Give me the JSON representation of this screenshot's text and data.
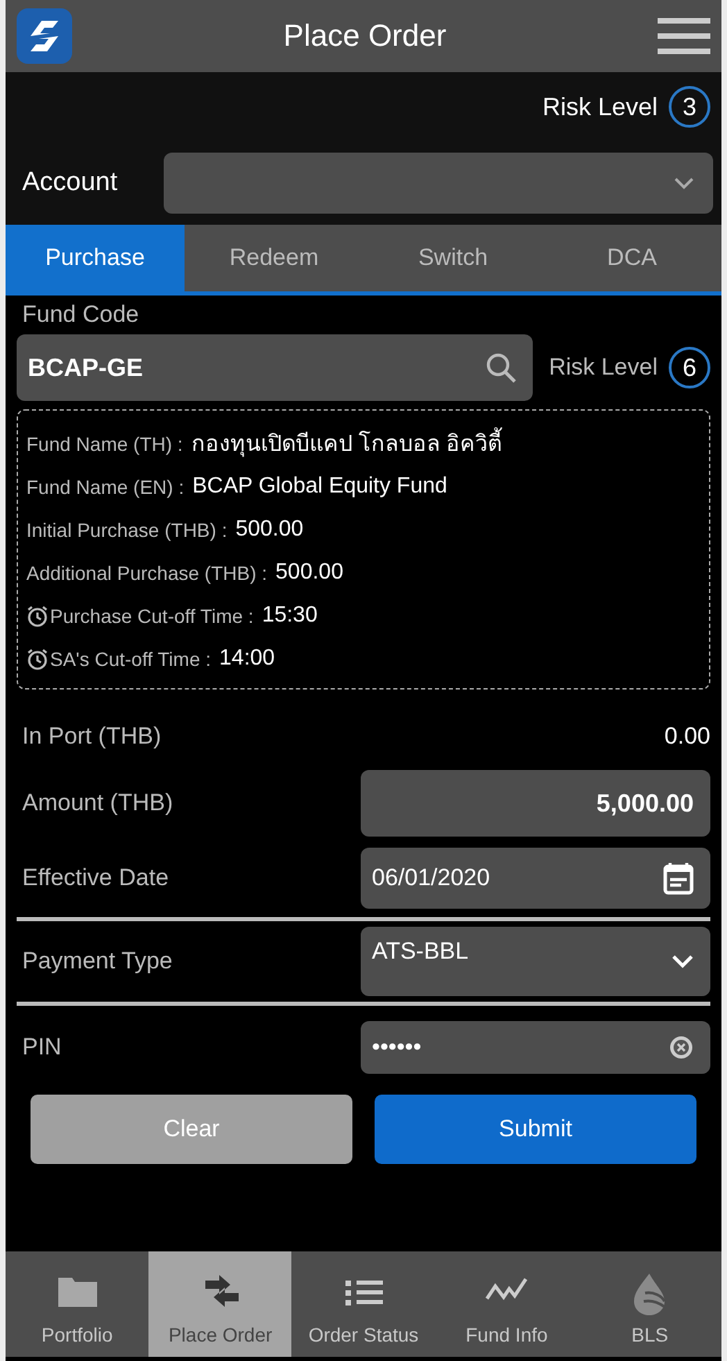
{
  "header": {
    "title": "Place Order"
  },
  "risk": {
    "label": "Risk Level",
    "value": "3"
  },
  "account": {
    "label": "Account"
  },
  "tabs": [
    {
      "label": "Purchase",
      "selected": true
    },
    {
      "label": "Redeem",
      "selected": false
    },
    {
      "label": "Switch",
      "selected": false
    },
    {
      "label": "DCA",
      "selected": false
    }
  ],
  "fund_code": {
    "label": "Fund Code",
    "value": "BCAP-GE",
    "risk_label": "Risk Level",
    "risk_value": "6"
  },
  "fund_info": [
    {
      "kind": "text",
      "label": "Fund Name (TH) :",
      "value": "กองทุนเปิดบีแคป โกลบอล อิควิตี้"
    },
    {
      "kind": "text",
      "label": "Fund Name (EN) :",
      "value": "BCAP Global Equity Fund"
    },
    {
      "kind": "text",
      "label": "Initial Purchase (THB) :",
      "value": "500.00"
    },
    {
      "kind": "text",
      "label": "Additional Purchase (THB) :",
      "value": "500.00"
    },
    {
      "kind": "time",
      "label": "Purchase Cut-off Time :",
      "value": "15:30"
    },
    {
      "kind": "time",
      "label": "SA's Cut-off Time :",
      "value": "14:00"
    }
  ],
  "form": [
    {
      "kind": "static",
      "label": "In Port (THB)",
      "value": "0.00"
    },
    {
      "kind": "amount",
      "label": "Amount (THB)",
      "value": "5,000.00"
    },
    {
      "kind": "date",
      "label": "Effective Date",
      "value": "06/01/2020"
    },
    {
      "kind": "select",
      "label": "Payment Type",
      "value": "ATS-BBL"
    },
    {
      "kind": "password",
      "label": "PIN",
      "value": "••••••"
    }
  ],
  "buttons": [
    {
      "kind": "secondary",
      "label": "Clear"
    },
    {
      "kind": "primary",
      "label": "Submit"
    }
  ],
  "nav": [
    {
      "kind": "folder",
      "label": "Portfolio",
      "selected": false
    },
    {
      "kind": "exchange",
      "label": "Place Order",
      "selected": true
    },
    {
      "kind": "list",
      "label": "Order Status",
      "selected": false
    },
    {
      "kind": "chart",
      "label": "Fund Info",
      "selected": false
    },
    {
      "kind": "drop",
      "label": "BLS",
      "selected": false
    }
  ]
}
